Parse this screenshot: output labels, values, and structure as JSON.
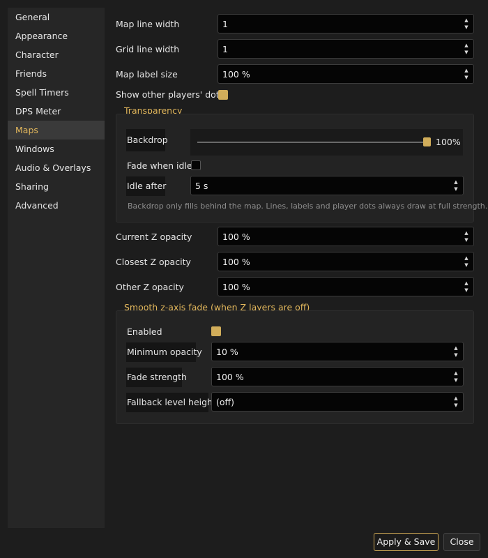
{
  "sidebar": {
    "items": [
      {
        "label": "General"
      },
      {
        "label": "Appearance"
      },
      {
        "label": "Character"
      },
      {
        "label": "Friends"
      },
      {
        "label": "Spell Timers"
      },
      {
        "label": "DPS Meter"
      },
      {
        "label": "Maps"
      },
      {
        "label": "Windows"
      },
      {
        "label": "Audio & Overlays"
      },
      {
        "label": "Sharing"
      },
      {
        "label": "Advanced"
      }
    ],
    "active": "Maps"
  },
  "maps": {
    "map_line_width": {
      "label": "Map line width",
      "value": "1"
    },
    "grid_line_width": {
      "label": "Grid line width",
      "value": "1"
    },
    "map_label_size": {
      "label": "Map label size",
      "value": "100 %"
    },
    "show_dots": {
      "label": "Show other players' dots",
      "checked": true
    },
    "transparency": {
      "title": "Transparency",
      "backdrop": {
        "label": "Backdrop",
        "value": 1.0,
        "display": "100%"
      },
      "fade_when_idle": {
        "label": "Fade when idle",
        "checked": false
      },
      "idle_after": {
        "label": "Idle after",
        "value": "5 s"
      },
      "hint": "Backdrop only fills behind the map. Lines, labels and player dots always draw at full strength."
    },
    "current_z": {
      "label": "Current Z opacity",
      "value": "100 %"
    },
    "closest_z": {
      "label": "Closest Z opacity",
      "value": "100 %"
    },
    "other_z": {
      "label": "Other Z opacity",
      "value": "100 %"
    },
    "smooth_fade": {
      "title": "Smooth z-axis fade (when Z layers are off)",
      "enabled": {
        "label": "Enabled",
        "checked": true
      },
      "min_opacity": {
        "label": "Minimum opacity",
        "value": "10 %"
      },
      "fade_strength": {
        "label": "Fade strength",
        "value": "100 %"
      },
      "fallback_height": {
        "label": "Fallback level height",
        "value": "(off)"
      }
    }
  },
  "footer": {
    "apply_label": "Apply & Save",
    "close_label": "Close"
  },
  "colors": {
    "accent": "#d1ad5a",
    "accent_text": "#e2b75c",
    "background": "#1d1d1d"
  }
}
